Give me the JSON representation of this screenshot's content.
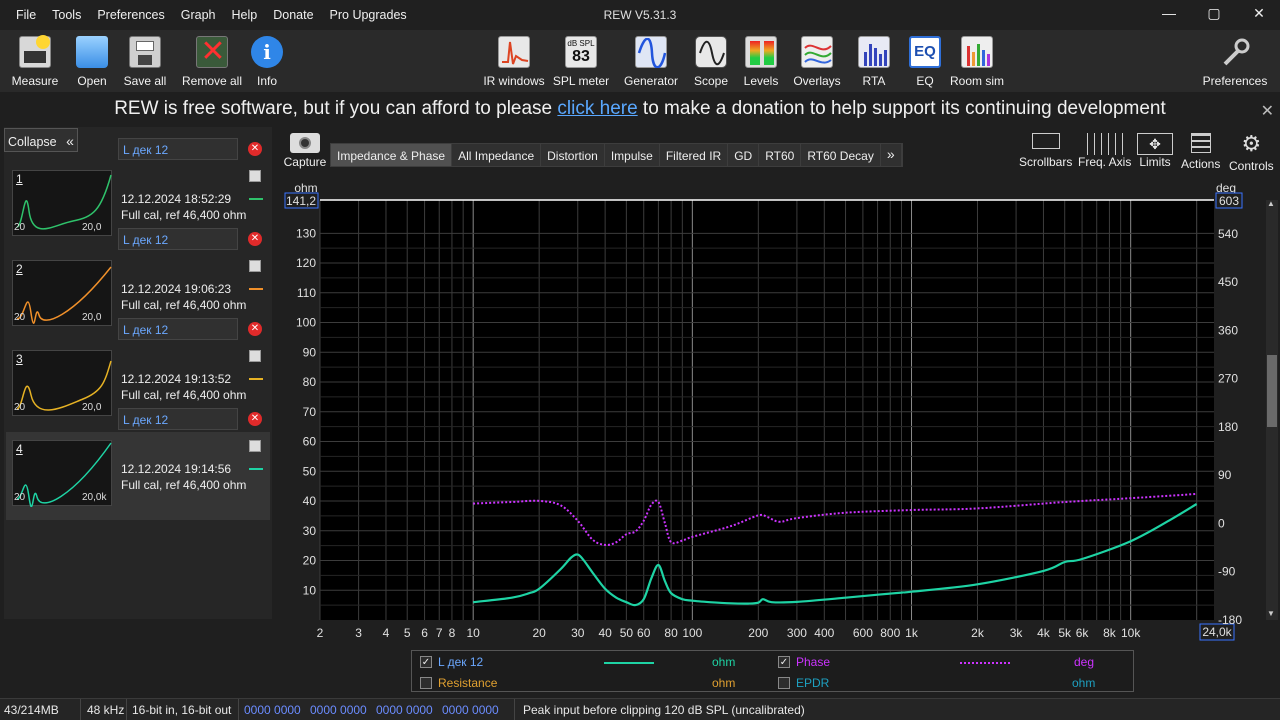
{
  "window": {
    "title": "REW V5.31.3",
    "menu": [
      "File",
      "Tools",
      "Preferences",
      "Graph",
      "Help",
      "Donate",
      "Pro Upgrades"
    ],
    "controls": [
      "—",
      "▢",
      "✕"
    ]
  },
  "toolbar": {
    "left": [
      {
        "label": "Measure",
        "icon": "measure-icon"
      },
      {
        "label": "Open",
        "icon": "folder-icon"
      },
      {
        "label": "Save all",
        "icon": "save-icon"
      },
      {
        "label": "Remove all",
        "icon": "remove-all-icon"
      },
      {
        "label": "Info",
        "icon": "info-icon"
      }
    ],
    "center": [
      {
        "label": "IR windows",
        "icon": "ir-windows-icon"
      },
      {
        "label": "SPL meter",
        "icon": "spl-meter-icon",
        "badge_top": "dB SPL",
        "badge_value": "83"
      },
      {
        "label": "Generator",
        "icon": "generator-icon"
      },
      {
        "label": "Scope",
        "icon": "scope-icon"
      },
      {
        "label": "Levels",
        "icon": "levels-icon"
      },
      {
        "label": "Overlays",
        "icon": "overlays-icon"
      },
      {
        "label": "RTA",
        "icon": "rta-icon"
      },
      {
        "label": "EQ",
        "icon": "eq-icon",
        "badge_value": "EQ"
      },
      {
        "label": "Room sim",
        "icon": "room-sim-icon"
      }
    ],
    "right": {
      "label": "Preferences",
      "icon": "wrench-icon"
    }
  },
  "banner": {
    "before": "REW is free software, but if you can afford to please ",
    "link": "click here",
    "after": " to make a donation to help support its continuing development",
    "close": "✕"
  },
  "sidebar": {
    "collapse_label": "Collapse",
    "collapse_icon": "«",
    "measurements": [
      {
        "num": "1",
        "name": "L дек 12",
        "date": "12.12.2024 18:52:29",
        "note": "Full cal, ref 46,400 ohm",
        "thumb_left": "20",
        "thumb_right": "20,0",
        "color": "#2fc26b"
      },
      {
        "num": "2",
        "name": "L дек 12",
        "date": "12.12.2024 19:06:23",
        "note": "Full cal, ref 46,400 ohm",
        "thumb_left": "20",
        "thumb_right": "20,0",
        "color": "#f0902a"
      },
      {
        "num": "3",
        "name": "L дек 12",
        "date": "12.12.2024 19:13:52",
        "note": "Full cal, ref 46,400 ohm",
        "thumb_left": "20",
        "thumb_right": "20,0",
        "color": "#e6b224"
      },
      {
        "num": "4",
        "name": "L дек 12",
        "date": "12.12.2024 19:14:56",
        "note": "Full cal, ref 46,400 ohm",
        "thumb_left": "20",
        "thumb_right": "20,0k",
        "color": "#1ed3a4"
      }
    ]
  },
  "graph_tabs": {
    "capture_label": "Capture",
    "tabs": [
      "Impedance & Phase",
      "All Impedance",
      "Distortion",
      "Impulse",
      "Filtered IR",
      "GD",
      "RT60",
      "RT60 Decay"
    ],
    "more": "»",
    "active": 0
  },
  "graph_tools": [
    {
      "label": "Scrollbars",
      "icon": "scrollbars-icon"
    },
    {
      "label": "Freq. Axis",
      "icon": "freq-axis-icon"
    },
    {
      "label": "Limits",
      "icon": "limits-icon"
    },
    {
      "label": "Actions",
      "icon": "actions-icon"
    },
    {
      "label": "Controls",
      "icon": "gear-icon"
    }
  ],
  "colors": {
    "impedance": "#1ed3a4",
    "phase": "#cc33ff",
    "resistance_label": "#e0a030",
    "epdr_label": "#1ea0c0",
    "axis_box": "#3a73ff"
  },
  "chart_data": {
    "type": "line",
    "x_scale": "log",
    "xlim": [
      2,
      24000
    ],
    "x_ticks": [
      {
        "v": 2,
        "t": "2"
      },
      {
        "v": 3,
        "t": "3"
      },
      {
        "v": 4,
        "t": "4"
      },
      {
        "v": 5,
        "t": "5"
      },
      {
        "v": 6,
        "t": "6"
      },
      {
        "v": 7,
        "t": "7"
      },
      {
        "v": 8,
        "t": "8"
      },
      {
        "v": 10,
        "t": "10"
      },
      {
        "v": 20,
        "t": "20"
      },
      {
        "v": 30,
        "t": "30"
      },
      {
        "v": 40,
        "t": "40"
      },
      {
        "v": 50,
        "t": "50"
      },
      {
        "v": 60,
        "t": "60"
      },
      {
        "v": 80,
        "t": "80"
      },
      {
        "v": 100,
        "t": "100"
      },
      {
        "v": 200,
        "t": "200"
      },
      {
        "v": 300,
        "t": "300"
      },
      {
        "v": 400,
        "t": "400"
      },
      {
        "v": 600,
        "t": "600"
      },
      {
        "v": 800,
        "t": "800"
      },
      {
        "v": 1000,
        "t": "1k"
      },
      {
        "v": 2000,
        "t": "2k"
      },
      {
        "v": 3000,
        "t": "3k"
      },
      {
        "v": 4000,
        "t": "4k"
      },
      {
        "v": 5000,
        "t": "5k"
      },
      {
        "v": 6000,
        "t": "6k"
      },
      {
        "v": 8000,
        "t": "8k"
      },
      {
        "v": 10000,
        "t": "10k"
      }
    ],
    "x_end_label": "24,0k",
    "ylabel_left": "ohm",
    "ylabel_right": "deg",
    "ylim_left": [
      0,
      141.2
    ],
    "ylim_left_top_label": "141,2",
    "y_ticks_left": [
      10,
      20,
      30,
      40,
      50,
      60,
      70,
      80,
      90,
      100,
      110,
      120,
      130
    ],
    "ylim_right": [
      -180,
      603
    ],
    "ylim_right_top_label": "603",
    "y_ticks_right": [
      -180,
      -90,
      0,
      90,
      180,
      270,
      360,
      450,
      540
    ],
    "series": [
      {
        "name": "L дек 12",
        "axis": "left",
        "unit": "ohm",
        "x": [
          10,
          15,
          18,
          20,
          25,
          28,
          30,
          32,
          35,
          40,
          45,
          50,
          55,
          60,
          65,
          70,
          75,
          80,
          90,
          100,
          120,
          150,
          180,
          200,
          210,
          230,
          300,
          500,
          700,
          900,
          1000,
          2000,
          4000,
          5000,
          6000,
          10000,
          15000,
          20000
        ],
        "y": [
          6,
          7.5,
          9,
          10.5,
          17,
          21,
          22,
          20,
          16,
          10.5,
          7.5,
          6,
          5,
          7,
          14,
          18.5,
          13,
          9,
          7,
          6.5,
          6,
          5.6,
          5.5,
          5.8,
          7,
          6,
          6.1,
          7.5,
          8.5,
          9.2,
          9.5,
          12,
          16.5,
          19.5,
          20.5,
          26.5,
          33.5,
          39
        ]
      },
      {
        "name": "Phase",
        "axis": "right",
        "unit": "deg",
        "x": [
          10,
          15,
          20,
          25,
          30,
          35,
          40,
          45,
          50,
          55,
          60,
          65,
          70,
          75,
          80,
          90,
          100,
          150,
          200,
          220,
          250,
          300,
          500,
          1000,
          2000,
          5000,
          10000,
          20000
        ],
        "y": [
          37,
          40,
          42,
          34,
          5,
          -30,
          -40,
          -35,
          -20,
          -15,
          5,
          35,
          40,
          0,
          -35,
          -32,
          -25,
          -5,
          15,
          12,
          3,
          10,
          20,
          25,
          28,
          40,
          47,
          55
        ]
      }
    ]
  },
  "legend": {
    "rows": [
      {
        "checked": true,
        "name": "L дек 12",
        "unit": "ohm",
        "color": "#1ed3a4",
        "line": "solid"
      },
      {
        "checked": true,
        "name": "Phase",
        "unit": "deg",
        "color": "#cc33ff",
        "line": "dotted"
      },
      {
        "checked": false,
        "name": "Resistance",
        "unit": "ohm",
        "color": "#e0a030",
        "line": "none"
      },
      {
        "checked": false,
        "name": "EPDR",
        "unit": "ohm",
        "color": "#1ea0c0",
        "line": "none"
      }
    ]
  },
  "status": {
    "memory": "43/214MB",
    "rate": "48 kHz",
    "bits": "16-bit in, 16-bit out",
    "levels": [
      "0000 0000",
      "0000 0000",
      "0000 0000",
      "0000 0000"
    ],
    "peak": "Peak input before clipping 120 dB SPL (uncalibrated)"
  }
}
